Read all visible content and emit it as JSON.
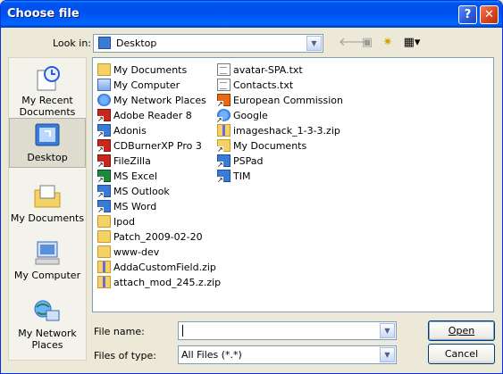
{
  "window": {
    "title": "Choose file",
    "help_label": "?",
    "close_label": "✕"
  },
  "lookin": {
    "label": "Look in:",
    "value": "Desktop"
  },
  "toolbar": {
    "back_icon": "back-arrow-icon",
    "up_icon": "up-folder-icon",
    "new_folder_icon": "new-folder-icon",
    "views_icon": "views-menu-icon"
  },
  "places": [
    {
      "label": "My Recent Documents",
      "icon": "recent-documents-icon"
    },
    {
      "label": "Desktop",
      "icon": "desktop-icon"
    },
    {
      "label": "My Documents",
      "icon": "my-documents-icon"
    },
    {
      "label": "My Computer",
      "icon": "my-computer-icon"
    },
    {
      "label": "My Network Places",
      "icon": "network-places-icon"
    }
  ],
  "files_col1": [
    {
      "name": "My Documents",
      "icon": "docs"
    },
    {
      "name": "My Computer",
      "icon": "pc"
    },
    {
      "name": "My Network Places",
      "icon": "net"
    },
    {
      "name": "Adobe Reader 8",
      "icon": "red shortcut"
    },
    {
      "name": "Adonis",
      "icon": "app shortcut"
    },
    {
      "name": "CDBurnerXP Pro 3",
      "icon": "red shortcut"
    },
    {
      "name": "FileZilla",
      "icon": "red shortcut"
    },
    {
      "name": "MS Excel",
      "icon": "green shortcut"
    },
    {
      "name": "MS Outlook",
      "icon": "app shortcut"
    },
    {
      "name": "MS Word",
      "icon": "app shortcut"
    },
    {
      "name": "Ipod",
      "icon": "folder"
    },
    {
      "name": "Patch_2009-02-20",
      "icon": "folder"
    },
    {
      "name": "www-dev",
      "icon": "folder"
    },
    {
      "name": "AddaCustomField.zip",
      "icon": "zip"
    },
    {
      "name": "attach_mod_245.z.zip",
      "icon": "zip"
    }
  ],
  "files_col2": [
    {
      "name": "avatar-SPA.txt",
      "icon": "txt"
    },
    {
      "name": "Contacts.txt",
      "icon": "txt"
    },
    {
      "name": "European Commission",
      "icon": "orange shortcut"
    },
    {
      "name": "Google",
      "icon": "net shortcut"
    },
    {
      "name": "imageshack_1-3-3.zip",
      "icon": "zip"
    },
    {
      "name": "My Documents",
      "icon": "docs shortcut"
    },
    {
      "name": "PSPad",
      "icon": "app shortcut"
    },
    {
      "name": "TIM",
      "icon": "app shortcut"
    }
  ],
  "filename": {
    "label": "File name:",
    "value": ""
  },
  "filetype": {
    "label": "Files of type:",
    "value": "All Files (*.*)"
  },
  "buttons": {
    "open": "Open",
    "cancel": "Cancel"
  }
}
